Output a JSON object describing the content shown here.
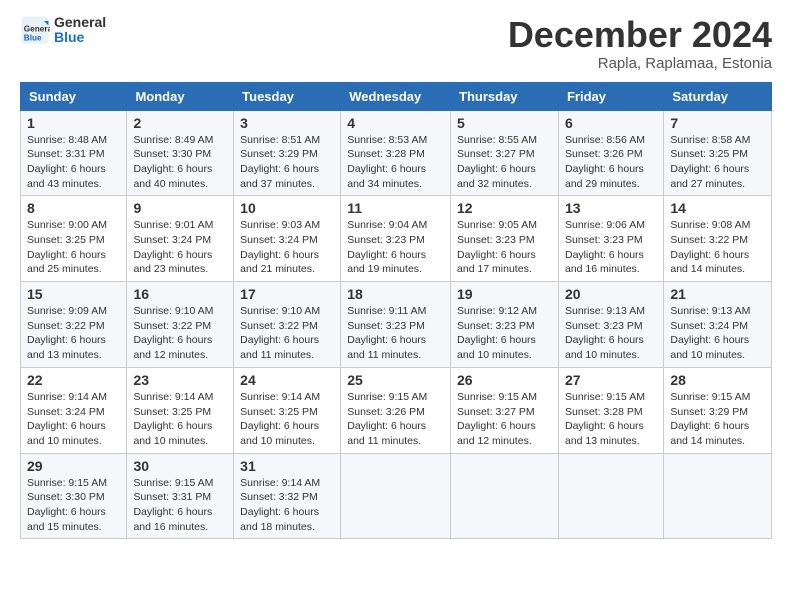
{
  "header": {
    "logo_general": "General",
    "logo_blue": "Blue",
    "month_title": "December 2024",
    "subtitle": "Rapla, Raplamaa, Estonia"
  },
  "days_of_week": [
    "Sunday",
    "Monday",
    "Tuesday",
    "Wednesday",
    "Thursday",
    "Friday",
    "Saturday"
  ],
  "weeks": [
    [
      {
        "day": "1",
        "info": "Sunrise: 8:48 AM\nSunset: 3:31 PM\nDaylight: 6 hours\nand 43 minutes."
      },
      {
        "day": "2",
        "info": "Sunrise: 8:49 AM\nSunset: 3:30 PM\nDaylight: 6 hours\nand 40 minutes."
      },
      {
        "day": "3",
        "info": "Sunrise: 8:51 AM\nSunset: 3:29 PM\nDaylight: 6 hours\nand 37 minutes."
      },
      {
        "day": "4",
        "info": "Sunrise: 8:53 AM\nSunset: 3:28 PM\nDaylight: 6 hours\nand 34 minutes."
      },
      {
        "day": "5",
        "info": "Sunrise: 8:55 AM\nSunset: 3:27 PM\nDaylight: 6 hours\nand 32 minutes."
      },
      {
        "day": "6",
        "info": "Sunrise: 8:56 AM\nSunset: 3:26 PM\nDaylight: 6 hours\nand 29 minutes."
      },
      {
        "day": "7",
        "info": "Sunrise: 8:58 AM\nSunset: 3:25 PM\nDaylight: 6 hours\nand 27 minutes."
      }
    ],
    [
      {
        "day": "8",
        "info": "Sunrise: 9:00 AM\nSunset: 3:25 PM\nDaylight: 6 hours\nand 25 minutes."
      },
      {
        "day": "9",
        "info": "Sunrise: 9:01 AM\nSunset: 3:24 PM\nDaylight: 6 hours\nand 23 minutes."
      },
      {
        "day": "10",
        "info": "Sunrise: 9:03 AM\nSunset: 3:24 PM\nDaylight: 6 hours\nand 21 minutes."
      },
      {
        "day": "11",
        "info": "Sunrise: 9:04 AM\nSunset: 3:23 PM\nDaylight: 6 hours\nand 19 minutes."
      },
      {
        "day": "12",
        "info": "Sunrise: 9:05 AM\nSunset: 3:23 PM\nDaylight: 6 hours\nand 17 minutes."
      },
      {
        "day": "13",
        "info": "Sunrise: 9:06 AM\nSunset: 3:23 PM\nDaylight: 6 hours\nand 16 minutes."
      },
      {
        "day": "14",
        "info": "Sunrise: 9:08 AM\nSunset: 3:22 PM\nDaylight: 6 hours\nand 14 minutes."
      }
    ],
    [
      {
        "day": "15",
        "info": "Sunrise: 9:09 AM\nSunset: 3:22 PM\nDaylight: 6 hours\nand 13 minutes."
      },
      {
        "day": "16",
        "info": "Sunrise: 9:10 AM\nSunset: 3:22 PM\nDaylight: 6 hours\nand 12 minutes."
      },
      {
        "day": "17",
        "info": "Sunrise: 9:10 AM\nSunset: 3:22 PM\nDaylight: 6 hours\nand 11 minutes."
      },
      {
        "day": "18",
        "info": "Sunrise: 9:11 AM\nSunset: 3:23 PM\nDaylight: 6 hours\nand 11 minutes."
      },
      {
        "day": "19",
        "info": "Sunrise: 9:12 AM\nSunset: 3:23 PM\nDaylight: 6 hours\nand 10 minutes."
      },
      {
        "day": "20",
        "info": "Sunrise: 9:13 AM\nSunset: 3:23 PM\nDaylight: 6 hours\nand 10 minutes."
      },
      {
        "day": "21",
        "info": "Sunrise: 9:13 AM\nSunset: 3:24 PM\nDaylight: 6 hours\nand 10 minutes."
      }
    ],
    [
      {
        "day": "22",
        "info": "Sunrise: 9:14 AM\nSunset: 3:24 PM\nDaylight: 6 hours\nand 10 minutes."
      },
      {
        "day": "23",
        "info": "Sunrise: 9:14 AM\nSunset: 3:25 PM\nDaylight: 6 hours\nand 10 minutes."
      },
      {
        "day": "24",
        "info": "Sunrise: 9:14 AM\nSunset: 3:25 PM\nDaylight: 6 hours\nand 10 minutes."
      },
      {
        "day": "25",
        "info": "Sunrise: 9:15 AM\nSunset: 3:26 PM\nDaylight: 6 hours\nand 11 minutes."
      },
      {
        "day": "26",
        "info": "Sunrise: 9:15 AM\nSunset: 3:27 PM\nDaylight: 6 hours\nand 12 minutes."
      },
      {
        "day": "27",
        "info": "Sunrise: 9:15 AM\nSunset: 3:28 PM\nDaylight: 6 hours\nand 13 minutes."
      },
      {
        "day": "28",
        "info": "Sunrise: 9:15 AM\nSunset: 3:29 PM\nDaylight: 6 hours\nand 14 minutes."
      }
    ],
    [
      {
        "day": "29",
        "info": "Sunrise: 9:15 AM\nSunset: 3:30 PM\nDaylight: 6 hours\nand 15 minutes."
      },
      {
        "day": "30",
        "info": "Sunrise: 9:15 AM\nSunset: 3:31 PM\nDaylight: 6 hours\nand 16 minutes."
      },
      {
        "day": "31",
        "info": "Sunrise: 9:14 AM\nSunset: 3:32 PM\nDaylight: 6 hours\nand 18 minutes."
      },
      {
        "day": "",
        "info": ""
      },
      {
        "day": "",
        "info": ""
      },
      {
        "day": "",
        "info": ""
      },
      {
        "day": "",
        "info": ""
      }
    ]
  ]
}
